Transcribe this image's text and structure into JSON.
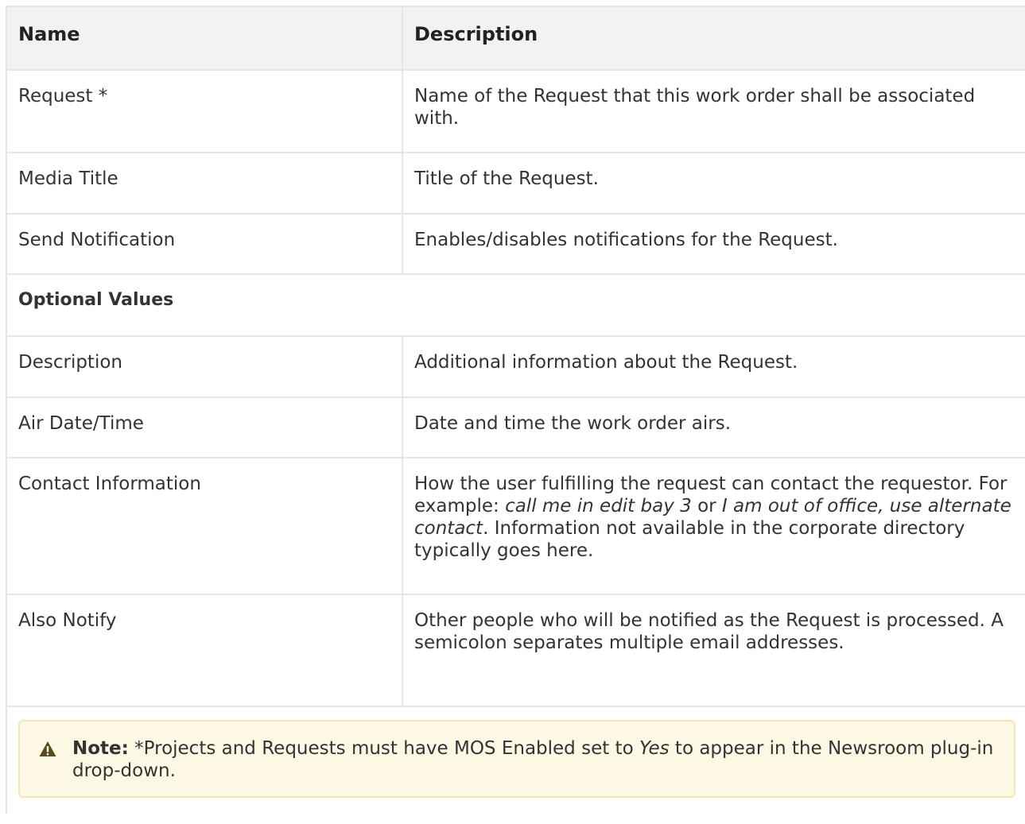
{
  "table": {
    "headers": [
      "Name",
      "Description"
    ],
    "rows": [
      {
        "name": "Request *",
        "desc": "Name of the Request that this work order shall be associated with."
      },
      {
        "name": "Media Title",
        "desc": "Title of the Request."
      },
      {
        "name": "Send Notification",
        "desc": "Enables/disables notifications for the Request."
      }
    ],
    "section_label": "Optional Values",
    "optional_rows": [
      {
        "name": "Description",
        "desc": "Additional information about the Request."
      },
      {
        "name": "Air Date/Time",
        "desc": "Date and time the work order airs."
      },
      {
        "name": "Contact Information",
        "desc_parts": [
          "How the user fulfilling the request can contact the requestor. For example: ",
          "call me in edit bay 3",
          " or ",
          "I am out of office, use alternate contact",
          ". Information not available in the corporate directory typically goes here."
        ]
      },
      {
        "name": "Also Notify",
        "desc": "Other people who will be notified as the Request is processed. A semicolon separates multiple email addresses."
      }
    ]
  },
  "note": {
    "icon": "warning-icon",
    "label": "Note:",
    "text_before": " *Projects and Requests must have MOS Enabled set to ",
    "emphasis": "Yes",
    "text_after": " to appear in the Newsroom plug-in drop-down."
  },
  "colors": {
    "header_bg": "#f2f2f2",
    "note_bg": "#fdf8e4",
    "note_border": "#f5e7b3",
    "border": "#e6e6e6"
  }
}
